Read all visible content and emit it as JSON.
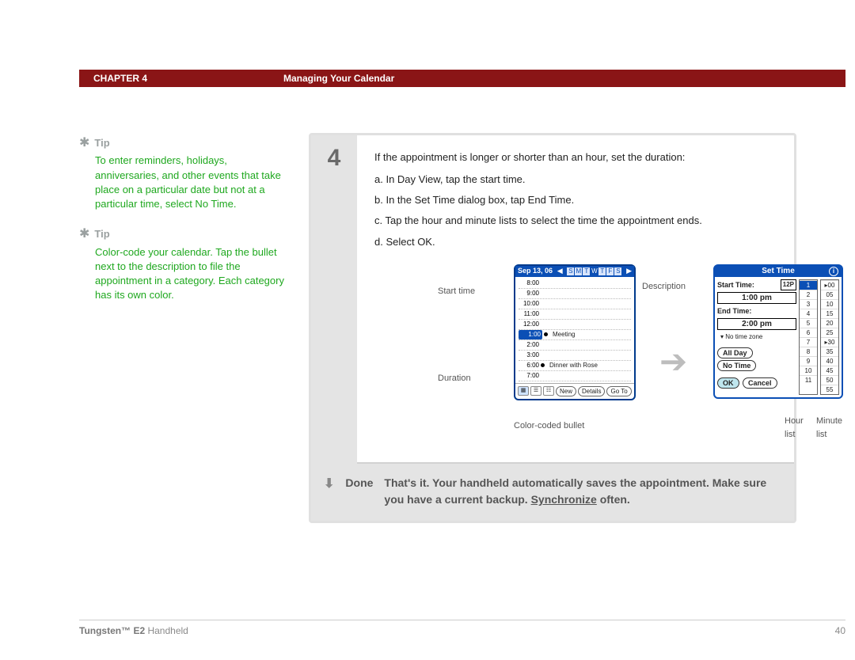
{
  "header": {
    "chapter": "CHAPTER 4",
    "title": "Managing Your Calendar"
  },
  "tips": [
    {
      "label": "Tip",
      "body": "To enter reminders, holidays, anniversaries, and other events that take place on a particular date but not at a particular time, select No Time."
    },
    {
      "label": "Tip",
      "body": "Color-code your calendar. Tap the bullet next to the description to file the appointment in a category. Each category has its own color."
    }
  ],
  "step": {
    "number": "4",
    "intro": "If the appointment is longer or shorter than an hour, set the duration:",
    "items": [
      "a.  In Day View, tap the start time.",
      "b.  In the Set Time dialog box, tap End Time.",
      "c.  Tap the hour and minute lists to select the time the appointment ends.",
      "d.  Select OK."
    ]
  },
  "callouts": {
    "start_time": "Start time",
    "duration": "Duration",
    "description": "Description",
    "color_bullet": "Color-coded bullet",
    "hour_list": "Hour list",
    "minute_list": "Minute list"
  },
  "dayview": {
    "date": "Sep 13, 06",
    "days": [
      "S",
      "M",
      "T",
      "W",
      "T",
      "F",
      "S"
    ],
    "selected_day_index": 3,
    "rows": [
      {
        "time": "8:00",
        "ev": ""
      },
      {
        "time": "9:00",
        "ev": ""
      },
      {
        "time": "10:00",
        "ev": ""
      },
      {
        "time": "11:00",
        "ev": ""
      },
      {
        "time": "12:00",
        "ev": ""
      },
      {
        "time": "1:00",
        "ev": "Meeting",
        "sel": true,
        "bullet": true
      },
      {
        "time": "2:00",
        "ev": ""
      },
      {
        "time": "3:00",
        "ev": ""
      },
      {
        "time": "6:00",
        "ev": "Dinner with Rose",
        "bullet": true
      },
      {
        "time": "7:00",
        "ev": ""
      }
    ],
    "footer": {
      "new": "New",
      "details": "Details",
      "goto": "Go To"
    }
  },
  "settime": {
    "title": "Set Time",
    "start_label": "Start Time:",
    "start_value": "1:00 pm",
    "start_suffix": "12P",
    "end_label": "End Time:",
    "end_value": "2:00 pm",
    "tz": "No time zone",
    "allday": "All Day",
    "notime": "No Time",
    "ok": "OK",
    "cancel": "Cancel",
    "hours": [
      "1",
      "2",
      "3",
      "4",
      "5",
      "6",
      "7",
      "8",
      "9",
      "10",
      "11"
    ],
    "hour_sel": 0,
    "minutes": [
      "00",
      "05",
      "10",
      "15",
      "20",
      "25",
      "30",
      "35",
      "40",
      "45",
      "50",
      "55"
    ],
    "minute_marks": [
      0,
      6
    ]
  },
  "done": {
    "label": "Done",
    "text1": "That's it. Your handheld automatically saves the appointment. Make sure you have a current backup. ",
    "link": "Synchronize",
    "text2": " often."
  },
  "footer": {
    "product_bold": "Tungsten™ E2",
    "product_rest": " Handheld",
    "page": "40"
  }
}
